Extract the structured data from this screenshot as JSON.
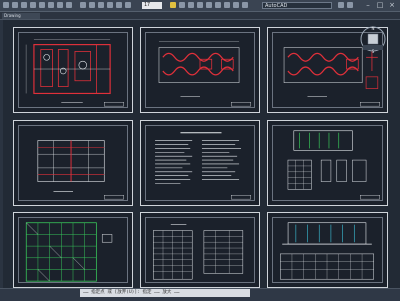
{
  "window": {
    "command_box": "17",
    "drawing_title": "AutoCAD",
    "tab_label": "Drawing",
    "min_glyph": "–",
    "max_glyph": "□",
    "close_glyph": "×"
  },
  "navcube": {
    "label_top": "N",
    "label_bottom": "S"
  },
  "command_line": {
    "text": "……  指定点 或 [放弃(U)]:  指定  ……  放大  ……"
  },
  "sheets": [
    {
      "id": "plan-1"
    },
    {
      "id": "plan-2"
    },
    {
      "id": "plan-3"
    },
    {
      "id": "elevation-1"
    },
    {
      "id": "notes"
    },
    {
      "id": "section-1"
    },
    {
      "id": "detail-1"
    },
    {
      "id": "tables"
    },
    {
      "id": "section-2"
    }
  ],
  "colors": {
    "background": "#222a35",
    "sheet_border": "#cfd4da",
    "drawing_red": "#e0303a",
    "drawing_white": "#e8ecf0",
    "drawing_green": "#38c75a",
    "drawing_cyan": "#3ec8e0"
  }
}
